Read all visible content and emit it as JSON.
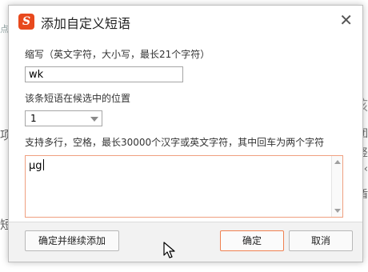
{
  "background": {
    "left_top": "点",
    "left_mid": "项",
    "left_bot": "短",
    "right_1": "核",
    "right_2": "团",
    "right_3": "竖",
    "right_4": "‹",
    "right_5": "盾"
  },
  "dialog": {
    "title": "添加自定义短语",
    "logo_letter": "S",
    "close_glyph": "✕",
    "abbr_label": "缩写（英文字符，大小写，最长21个字符）",
    "abbr_value": "wk",
    "position_label": "该条短语在候选中的位置",
    "position_value": "1",
    "content_label": "支持多行，空格，最长30000个汉字或英文字符，其中回车为两个字符",
    "content_value": "μg",
    "buttons": {
      "continue": "确定并继续添加",
      "ok": "确定",
      "cancel": "取消"
    }
  },
  "colors": {
    "brand": "#e8491d",
    "focus_border": "#f08050"
  }
}
